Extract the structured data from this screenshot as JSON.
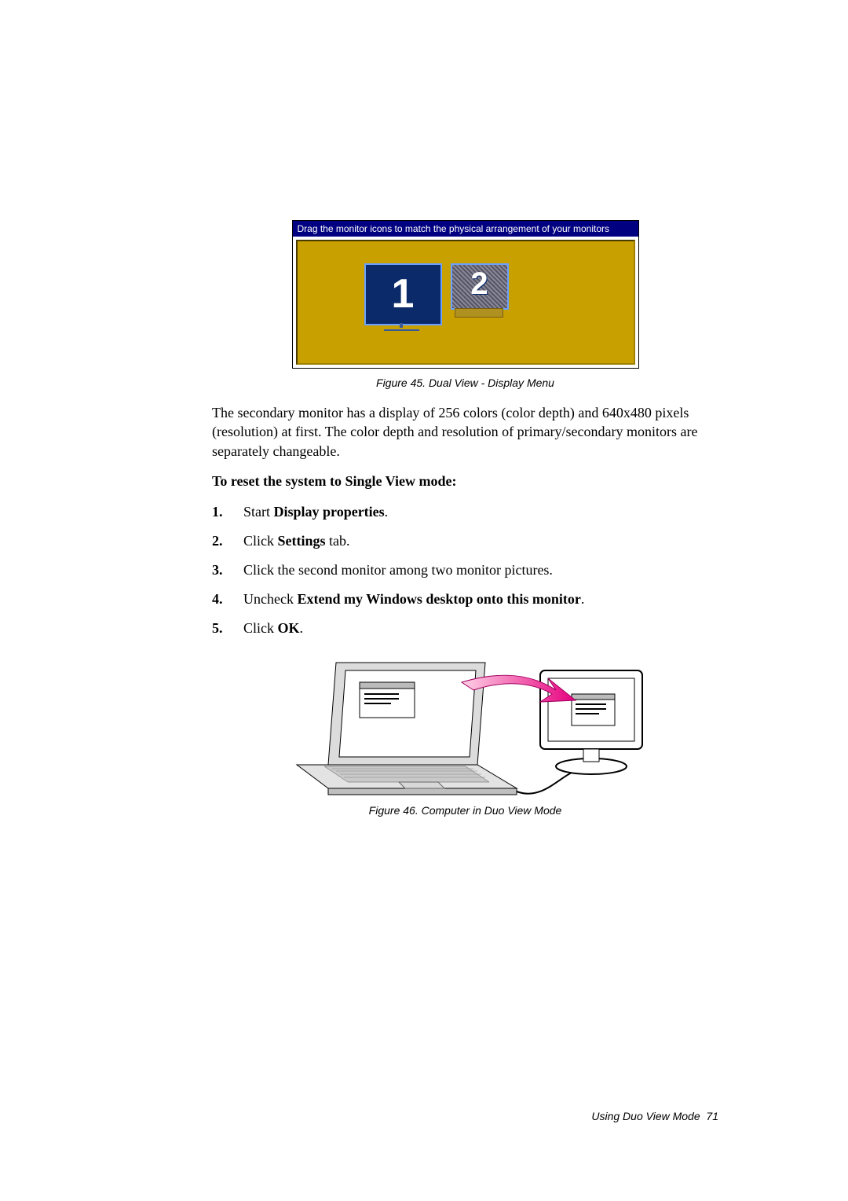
{
  "fig45": {
    "titlebar": "Drag the monitor icons to match the physical arrangement of your monitors",
    "mon1": "1",
    "mon2": "2",
    "caption": "Figure 45.  Dual View - Display Menu"
  },
  "paragraph": "The secondary monitor has a display of 256 colors (color depth) and 640x480 pixels (resolution) at first. The color depth and resolution of primary/secondary monitors are separately changeable.",
  "resetHeading": "To reset the system to Single View mode:",
  "steps": {
    "s1_num": "1.",
    "s1_pre": "Start ",
    "s1_bold": "Display properties",
    "s1_post": ".",
    "s2_num": "2.",
    "s2_pre": "Click ",
    "s2_bold": "Settings",
    "s2_post": " tab.",
    "s3_num": "3.",
    "s3_text": "Click the second monitor among two monitor pictures.",
    "s4_num": "4.",
    "s4_pre": "Uncheck ",
    "s4_bold": "Extend my Windows desktop onto this monitor",
    "s4_post": ".",
    "s5_num": "5.",
    "s5_pre": "Click ",
    "s5_bold": "OK",
    "s5_post": "."
  },
  "fig46_caption": "Figure 46.  Computer in Duo View Mode",
  "footer_section": "Using Duo View Mode",
  "footer_page": "71"
}
